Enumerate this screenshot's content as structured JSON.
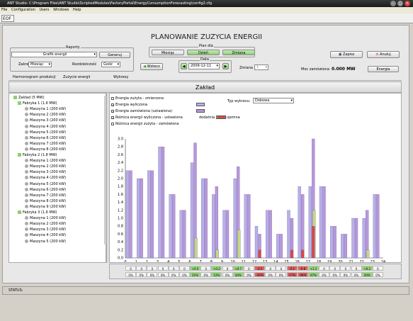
{
  "window": {
    "title": "ANT Studio: C:\\Program Files\\ANT Studio\\ScriptedModules\\FactoryPortal\\EnergyConsumptionForecasting\\config2.cfg"
  },
  "menu": [
    "File",
    "Configuration",
    "Users",
    "Windows",
    "Help"
  ],
  "toolbar": {
    "eof": "EOF"
  },
  "page": {
    "title": "PLANOWANIE ZUZYCIA ENERGII"
  },
  "raporty": {
    "label": "Raporty",
    "select_value": "Grafik energii",
    "generuj": "Generuj"
  },
  "zakres": {
    "label": "Zakres",
    "value": "Miesiąc"
  },
  "rozdzielczosc": {
    "label": "Rozdzielczość",
    "value": "Godz"
  },
  "plan": {
    "label": "Plan dla",
    "tabs": [
      "Miesiąc",
      "Dzień",
      "Zmiana"
    ],
    "active": "Dzień"
  },
  "data": {
    "label": "Data",
    "value": "2009-12-11"
  },
  "zmiana": {
    "label": "Zmiana",
    "value": "1"
  },
  "wstecz": "Wstecz",
  "zapisz": "Zapisz",
  "anuluj": "Anuluj",
  "moc": {
    "label": "Moc zamówiona",
    "value": "0.000 MW"
  },
  "energia_btn": "Energia",
  "subtabs": [
    "Harmonogram produkcji",
    "Zużycie energii",
    "Wykresy"
  ],
  "section_title": "Zakład",
  "tree": {
    "root": "Zakład (5 MW)",
    "factories": [
      {
        "name": "Fabryka 1 (1.6 MW)",
        "machines": [
          "Maszyna 1 (200 kW)",
          "Maszyna 2 (200 kW)",
          "Maszyna 3 (200 kW)",
          "Maszyna 4 (200 kW)",
          "Maszyna 5 (200 kW)",
          "Maszyna 6 (200 kW)",
          "Maszyna 7 (200 kW)",
          "Maszyna 8 (200 kW)"
        ]
      },
      {
        "name": "Fabryka 2 (1.8 MW)",
        "machines": [
          "Maszyna 1 (200 kW)",
          "Maszyna 2 (200 kW)",
          "Maszyna 3 (200 kW)",
          "Maszyna 4 (200 kW)",
          "Maszyna 5 (200 kW)",
          "Maszyna 6 (200 kW)",
          "Maszyna 7 (200 kW)",
          "Maszyna 8 (200 kW)",
          "Maszyna 9 (200 kW)"
        ]
      },
      {
        "name": "Fabryka 3 (1.6 MW)",
        "machines": [
          "Maszyna 1 (200 kW)",
          "Maszyna 2 (200 kW)",
          "Maszyna 3 (200 kW)",
          "Maszyna 4 (200 kW)",
          "Maszyna 5 (200 kW)"
        ]
      }
    ]
  },
  "legend": {
    "items": [
      "Energia zużyta - zmierzona",
      "Energia wyliczona",
      "Energia zamówiona (ustawiona)",
      "Różnica energii wyliczona - ustawiona",
      "Różnica energii zużyta - zamówiona"
    ],
    "checked": [
      false,
      true,
      true,
      true,
      false
    ],
    "dodatnia": "dodatnia",
    "ujemna": "ujemna",
    "typ_label": "Typ wykresu:",
    "typ_value": "Dobowa"
  },
  "colors": {
    "wyliczona": "#b8b0e8",
    "zamowiona": "#b898d8",
    "dodatnia": "#c8d880",
    "ujemna": "#d84848",
    "table_green": "#90d870",
    "table_red": "#e06060"
  },
  "chart_data": {
    "type": "bar",
    "x": [
      0,
      1,
      2,
      3,
      4,
      5,
      6,
      7,
      8,
      9,
      10,
      11,
      12,
      13,
      14,
      15,
      16,
      17,
      18,
      19,
      20,
      21,
      22,
      23
    ],
    "xticks": [
      0,
      1,
      2,
      3,
      4,
      5,
      6,
      7,
      8,
      9,
      10,
      11,
      12,
      13,
      14,
      15,
      16,
      17,
      18,
      19,
      20,
      21,
      22,
      23,
      24
    ],
    "yticks": [
      "0.0",
      "0.2",
      "0.4",
      "0.6",
      "0.8",
      "1.0",
      "1.2",
      "1.4",
      "1.6",
      "1.8",
      "2.0",
      "2.2",
      "2.4",
      "2.6",
      "2.8",
      "3.0"
    ],
    "ylim": [
      0,
      3.0
    ],
    "series": [
      {
        "values": [
          2.2,
          2.0,
          2.2,
          2.8,
          1.6,
          1.2,
          2.4,
          2.0,
          1.6,
          1.2,
          2.0,
          1.6,
          0.8,
          1.2,
          0.6,
          1.2,
          1.8,
          1.8,
          1.8,
          0.8,
          0.6,
          1.0,
          1.0,
          1.6
        ]
      },
      {
        "values": [
          2.2,
          2.0,
          2.2,
          2.8,
          1.6,
          1.2,
          2.9,
          2.0,
          1.8,
          1.2,
          2.3,
          1.6,
          0.6,
          1.2,
          0.6,
          1.0,
          1.6,
          3.0,
          1.8,
          0.8,
          0.6,
          1.0,
          1.2,
          1.6
        ]
      },
      {
        "values": [
          0,
          0,
          0,
          0,
          0,
          0,
          0.5,
          0,
          0.2,
          0,
          0.7,
          0,
          0,
          0,
          0,
          0,
          0,
          1.2,
          0,
          0,
          0,
          0,
          0.2,
          0
        ]
      },
      {
        "values": [
          0,
          0,
          0,
          0,
          0,
          0,
          0,
          0,
          0,
          0,
          0,
          0,
          -0.2,
          0,
          0,
          -0.2,
          -0.2,
          -0.8,
          0,
          0,
          0,
          0,
          0,
          0
        ]
      }
    ]
  },
  "table": {
    "row1": [
      "0",
      "0",
      "0",
      "0",
      "0",
      "0",
      "+0.5",
      "0",
      "+0.2",
      "0",
      "+0.7",
      "0",
      "-0.2",
      "0",
      "0",
      "-0.2",
      "-0.8",
      "+1.2",
      "0",
      "0",
      "0",
      "0",
      "+0.2",
      "0"
    ],
    "row2": [
      "0%",
      "0%",
      "0%",
      "0%",
      "0%",
      "0%",
      "21%",
      "0%",
      "12%",
      "0%",
      "44%",
      "0%",
      "-20%",
      "0%",
      "0%",
      "-17%",
      "-44%",
      "67%",
      "0%",
      "0%",
      "0%",
      "0%",
      "20%",
      "0%"
    ]
  },
  "status": "STATUS:"
}
